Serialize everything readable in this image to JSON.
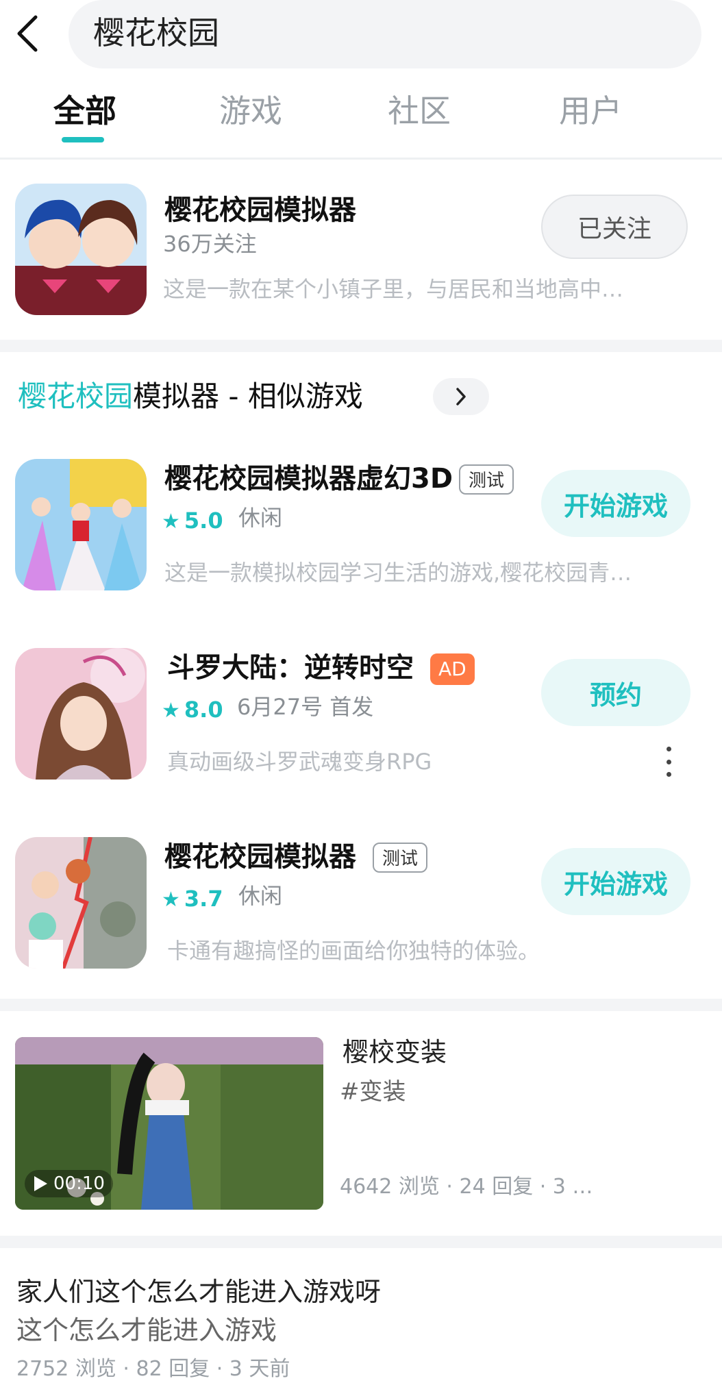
{
  "search": {
    "query": "樱花校园"
  },
  "tabs": [
    {
      "label": "全部",
      "active": true
    },
    {
      "label": "游戏",
      "active": false
    },
    {
      "label": "社区",
      "active": false
    },
    {
      "label": "用户",
      "active": false
    }
  ],
  "top_result": {
    "name": "樱花校园模拟器",
    "followers": "36万关注",
    "description": "这是一款在某个小镇子里，与居民和当地高中…",
    "follow_label": "已关注"
  },
  "similar": {
    "highlight": "樱花校园",
    "rest": "模拟器 - 相似游戏",
    "arrow_icon": "chevron-right-icon"
  },
  "games": [
    {
      "name": "樱花校园模拟器虚幻3D",
      "badge": "测试",
      "rating": "5.0",
      "category": "休闲",
      "description": "这是一款模拟校园学习生活的游戏,樱花校园青…",
      "action": "开始游戏"
    },
    {
      "name": "斗罗大陆：逆转时空",
      "badge": "AD",
      "rating": "8.0",
      "category": "6月27号 首发",
      "description": "真动画级斗罗武魂变身RPG",
      "action": "预约"
    },
    {
      "name": "樱花校园模拟器",
      "badge": "测试",
      "rating": "3.7",
      "category": "休闲",
      "description": "卡通有趣搞怪的画面给你独特的体验。",
      "action": "开始游戏"
    }
  ],
  "video_post": {
    "duration": "00:10",
    "title": "樱校变装",
    "tag": "#变装",
    "stats": "4642 浏览 · 24 回复 · 3 …"
  },
  "text_post": {
    "title": "家人们这个怎么才能进入游戏呀",
    "body": "这个怎么才能进入游戏",
    "stats": "2752 浏览 · 82 回复 · 3 天前"
  },
  "colors": {
    "accent": "#1fbfbf",
    "ad_badge": "#ff7a45",
    "button_bg": "#e8f8f8"
  }
}
